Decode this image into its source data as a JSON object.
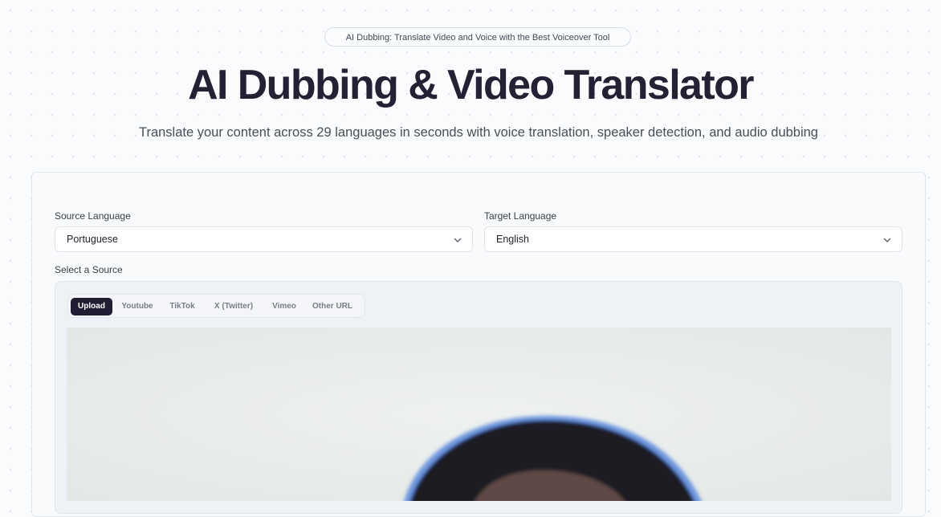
{
  "hero": {
    "badge": "AI Dubbing: Translate Video and Voice with the Best Voiceover Tool",
    "title": "AI Dubbing & Video Translator",
    "subtitle": "Translate your content across 29 languages in seconds with voice translation, speaker detection, and audio dubbing"
  },
  "form": {
    "source_language_label": "Source Language",
    "source_language_value": "Portuguese",
    "target_language_label": "Target Language",
    "target_language_value": "English",
    "select_source_label": "Select a Source"
  },
  "source_tabs": [
    {
      "label": "Upload",
      "active": true
    },
    {
      "label": "Youtube",
      "active": false
    },
    {
      "label": "TikTok",
      "active": false
    },
    {
      "label": "X (Twitter)",
      "active": false
    },
    {
      "label": "Vimeo",
      "active": false
    },
    {
      "label": "Other URL",
      "active": false
    }
  ],
  "icons": {
    "dropdown": "chevron-down-icon"
  },
  "colors": {
    "heading": "#232235",
    "active_tab_bg": "#211e33",
    "background": "#fafbfc"
  }
}
